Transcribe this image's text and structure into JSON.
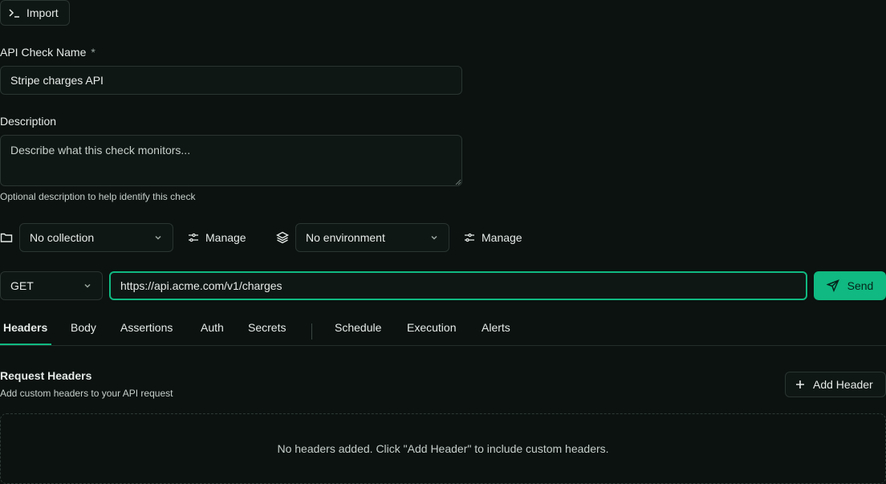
{
  "toolbar": {
    "import_label": "Import"
  },
  "form": {
    "name_label": "API Check Name",
    "name_required": "*",
    "name_value": "Stripe charges API",
    "description_label": "Description",
    "description_placeholder": "Describe what this check monitors...",
    "description_hint": "Optional description to help identify this check"
  },
  "selectors": {
    "collection_value": "No collection",
    "collection_manage": "Manage",
    "environment_value": "No environment",
    "environment_manage": "Manage"
  },
  "request": {
    "method": "GET",
    "url": "https://api.acme.com/v1/charges",
    "send_label": "Send"
  },
  "tabs": [
    {
      "label": "Headers",
      "active": true
    },
    {
      "label": "Body"
    },
    {
      "label": "Assertions"
    },
    {
      "label": "Auth"
    },
    {
      "label": "Secrets"
    },
    {
      "label": "Schedule"
    },
    {
      "label": "Execution"
    },
    {
      "label": "Alerts"
    }
  ],
  "headers_section": {
    "title": "Request Headers",
    "subtitle": "Add custom headers to your API request",
    "add_label": "Add Header",
    "empty_text": "No headers added. Click \"Add Header\" to include custom headers."
  },
  "colors": {
    "accent": "#10b981",
    "background": "#0b1210",
    "border": "#2a3430"
  }
}
